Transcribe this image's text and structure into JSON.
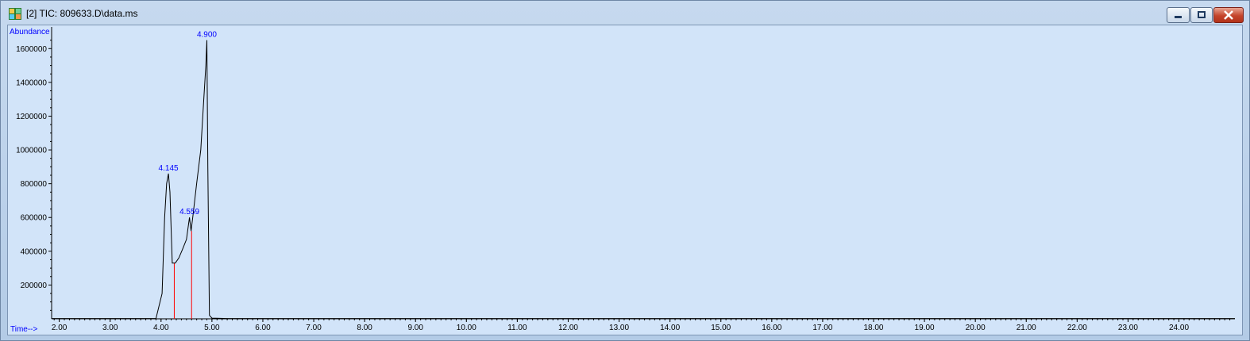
{
  "window": {
    "title": "[2] TIC: 809633.D\\data.ms",
    "controls": {
      "minimize_icon": "minimize-icon",
      "maximize_icon": "restore-icon",
      "close_icon": "close-icon"
    }
  },
  "colors": {
    "background": "#d2e4f9",
    "trace": "#000000",
    "axis_text": "#0000ff",
    "integration_lines": "#ff0000",
    "peak_labels": "#0000ff"
  },
  "chart_data": {
    "type": "line",
    "title": "",
    "ylabel": "Abundance",
    "xlabel": "Time-->",
    "xlim": [
      1.85,
      25.1
    ],
    "ylim": [
      0,
      1700000
    ],
    "x_ticks": [
      "2.00",
      "3.00",
      "4.00",
      "5.00",
      "6.00",
      "7.00",
      "8.00",
      "9.00",
      "10.00",
      "11.00",
      "12.00",
      "13.00",
      "14.00",
      "15.00",
      "16.00",
      "17.00",
      "18.00",
      "19.00",
      "20.00",
      "21.00",
      "22.00",
      "23.00",
      "24.00"
    ],
    "y_ticks": [
      "200000",
      "400000",
      "600000",
      "800000",
      "1000000",
      "1200000",
      "1400000",
      "1600000"
    ],
    "series": [
      {
        "x": [
          1.85,
          3.9,
          4.02,
          4.07,
          4.11,
          4.145,
          4.175,
          4.22,
          4.28,
          4.35,
          4.42,
          4.5,
          4.54,
          4.559,
          4.59,
          4.63,
          4.7,
          4.78,
          4.84,
          4.88,
          4.9,
          4.92,
          4.95,
          5.0,
          5.3,
          25.1
        ],
        "y": [
          2000,
          2000,
          150000,
          600000,
          800000,
          860000,
          750000,
          330000,
          330000,
          360000,
          410000,
          470000,
          560000,
          600000,
          520000,
          620000,
          800000,
          1000000,
          1300000,
          1500000,
          1650000,
          900000,
          20000,
          4000,
          2000,
          2000
        ]
      }
    ],
    "peaks": [
      {
        "label": "4.145",
        "x": 4.145,
        "y": 860000
      },
      {
        "label": "4.559",
        "x": 4.559,
        "y": 600000
      },
      {
        "label": "4.900",
        "x": 4.9,
        "y": 1650000
      }
    ],
    "integration_markers": [
      {
        "x": 4.26,
        "y": 330000
      },
      {
        "x": 4.6,
        "y": 520000
      }
    ]
  }
}
